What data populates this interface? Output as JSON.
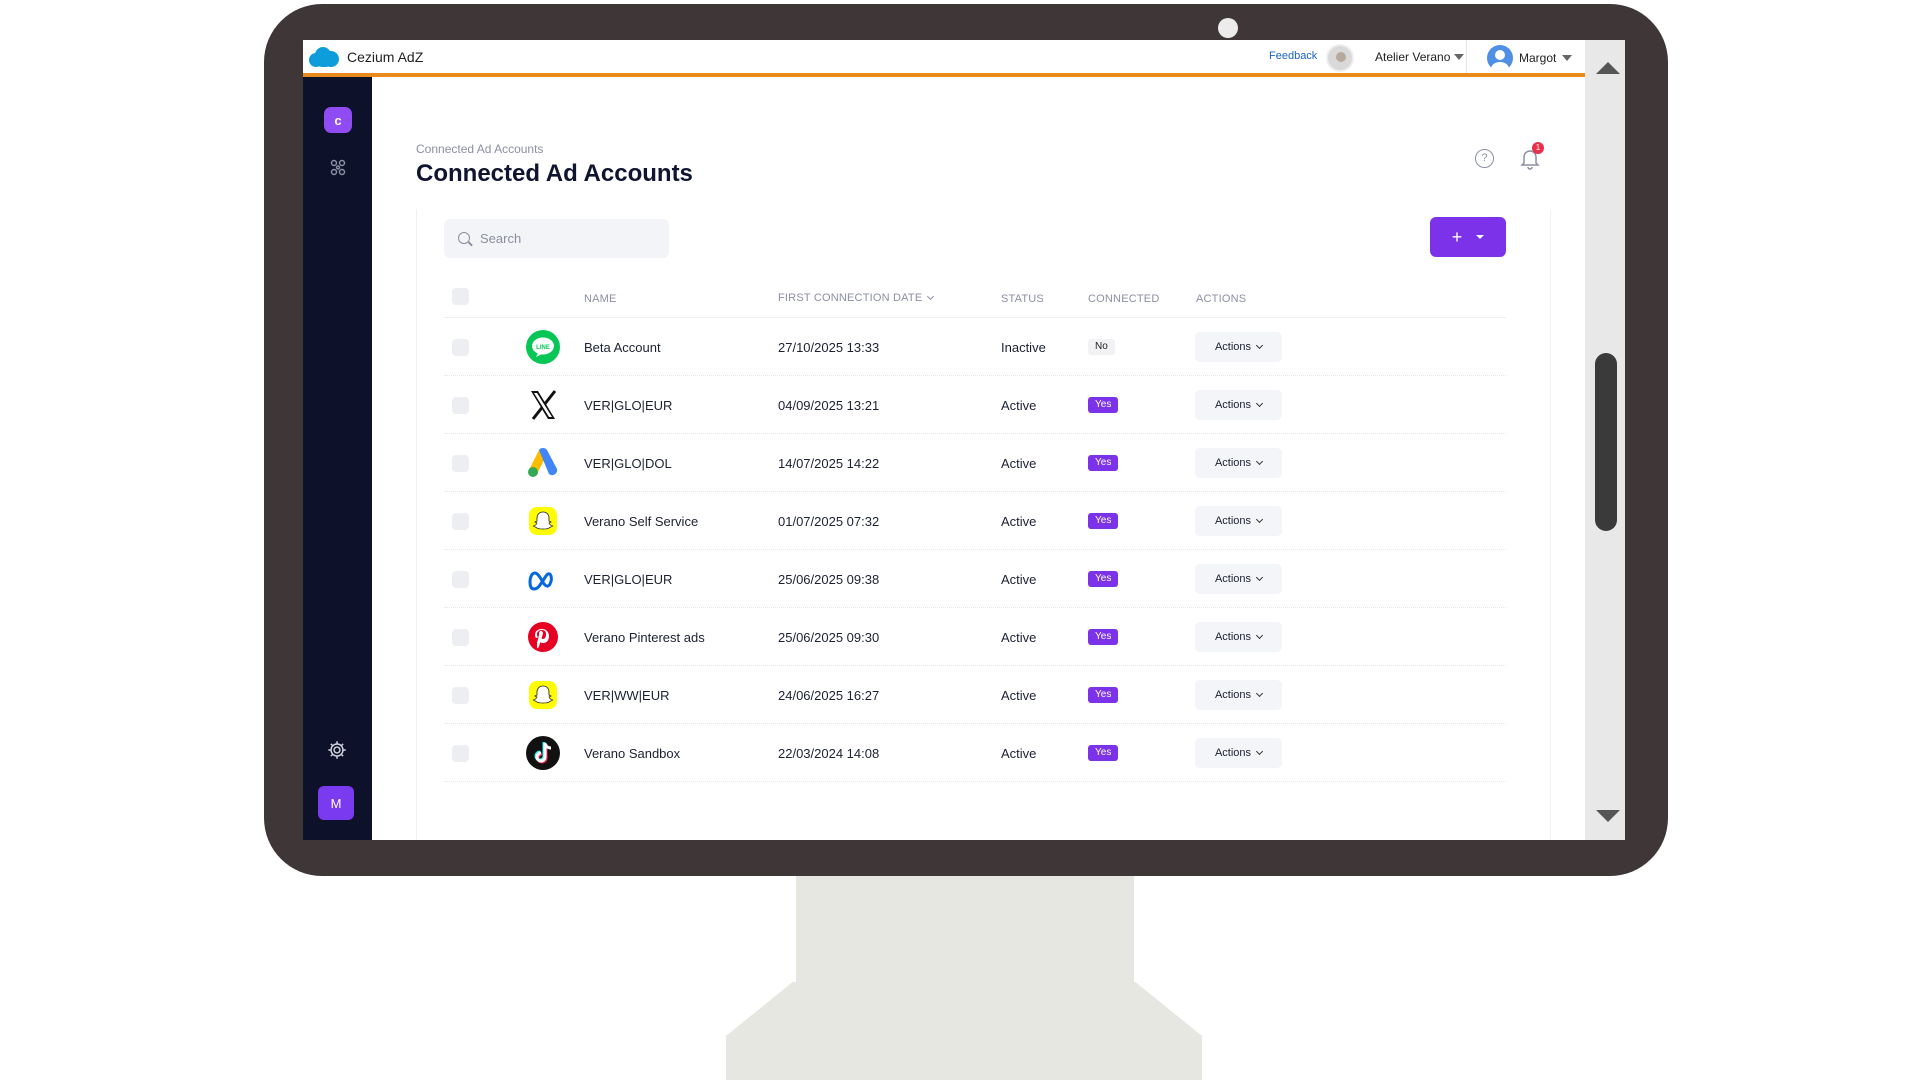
{
  "topbar": {
    "app_name": "Cezium AdZ",
    "feedback": "Feedback",
    "org": "Atelier Verano",
    "user": "Margot"
  },
  "sidebar": {
    "logo_letter": "c",
    "avatar_letter": "M"
  },
  "page": {
    "breadcrumb": "Connected Ad Accounts",
    "title": "Connected Ad Accounts",
    "notifications_count": "1",
    "help_glyph": "?"
  },
  "search": {
    "placeholder": "Search"
  },
  "add_button": {
    "label": "+"
  },
  "columns": {
    "name": "NAME",
    "first_connection_date": "FIRST CONNECTION DATE",
    "status": "STATUS",
    "connected": "CONNECTED",
    "actions": "ACTIONS"
  },
  "rows": [
    {
      "platform": "line-icon",
      "name": "Beta Account",
      "date": "27/10/2025 13:33",
      "status": "Inactive",
      "connected": "No",
      "action": "Actions"
    },
    {
      "platform": "x-icon",
      "name": "VER|GLO|EUR",
      "date": "04/09/2025 13:21",
      "status": "Active",
      "connected": "Yes",
      "action": "Actions"
    },
    {
      "platform": "google-ads-icon",
      "name": "VER|GLO|DOL",
      "date": "14/07/2025 14:22",
      "status": "Active",
      "connected": "Yes",
      "action": "Actions"
    },
    {
      "platform": "snapchat-icon",
      "name": "Verano Self Service",
      "date": "01/07/2025 07:32",
      "status": "Active",
      "connected": "Yes",
      "action": "Actions"
    },
    {
      "platform": "meta-icon",
      "name": "VER|GLO|EUR",
      "date": "25/06/2025 09:38",
      "status": "Active",
      "connected": "Yes",
      "action": "Actions"
    },
    {
      "platform": "pinterest-icon",
      "name": "Verano Pinterest ads",
      "date": "25/06/2025 09:30",
      "status": "Active",
      "connected": "Yes",
      "action": "Actions"
    },
    {
      "platform": "snapchat-icon",
      "name": "VER|WW|EUR",
      "date": "24/06/2025 16:27",
      "status": "Active",
      "connected": "Yes",
      "action": "Actions"
    },
    {
      "platform": "tiktok-icon",
      "name": "Verano Sandbox",
      "date": "22/03/2024 14:08",
      "status": "Active",
      "connected": "Yes",
      "action": "Actions"
    }
  ],
  "colors": {
    "accent": "#7b32e8",
    "sidebar": "#0d1129",
    "topbar_accent": "#e98a1d"
  }
}
